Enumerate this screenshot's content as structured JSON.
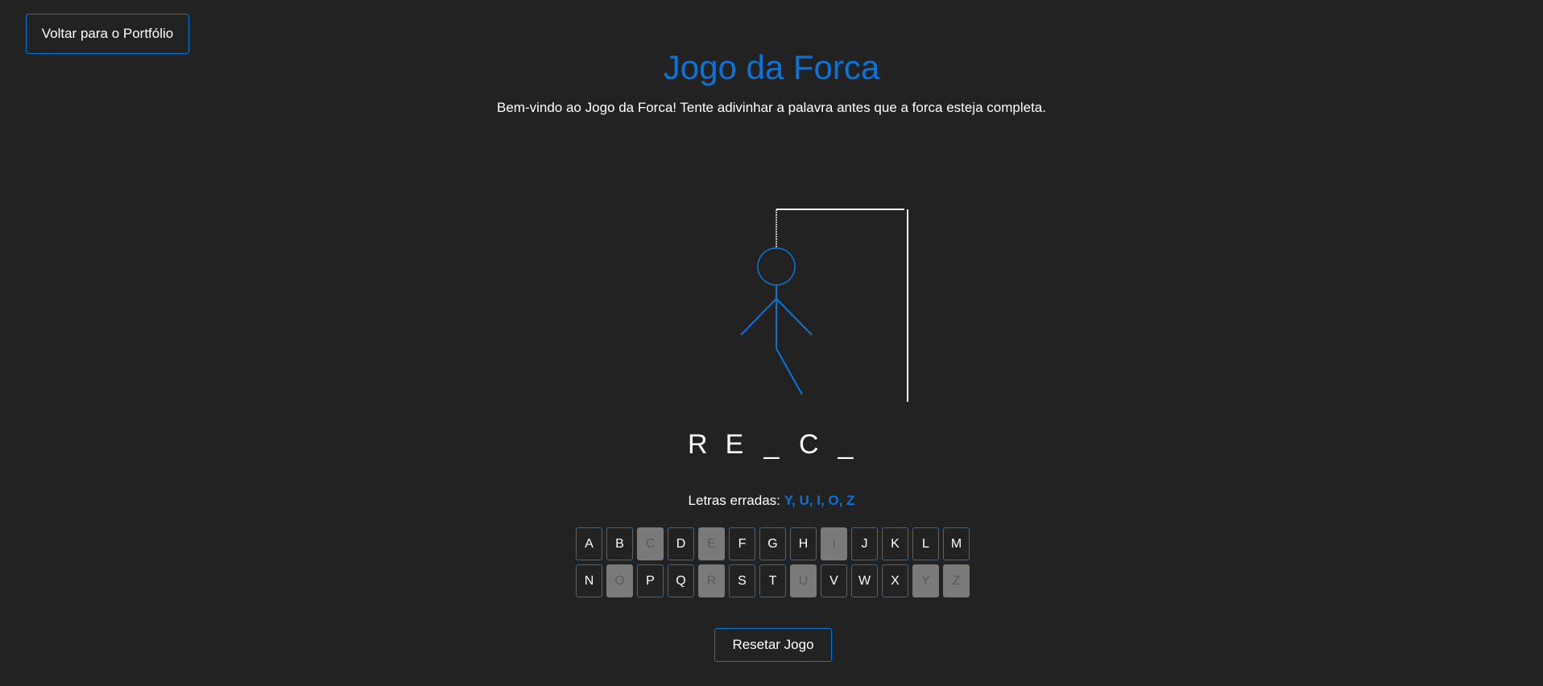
{
  "back_button": {
    "label": "Voltar para o Portfólio"
  },
  "header": {
    "title": "Jogo da Forca",
    "subtitle": "Bem-vindo ao Jogo da Forca! Tente adivinhar a palavra antes que a forca esteja completa."
  },
  "word": {
    "letters": [
      "R",
      "E",
      "_",
      "C",
      "_"
    ]
  },
  "wrong": {
    "label": "Letras erradas: ",
    "letters": "Y, U, I, O, Z"
  },
  "keyboard": {
    "rows": [
      [
        "A",
        "B",
        "C",
        "D",
        "E",
        "F",
        "G",
        "H",
        "I",
        "J",
        "K",
        "L",
        "M"
      ],
      [
        "N",
        "O",
        "P",
        "Q",
        "R",
        "S",
        "T",
        "U",
        "V",
        "W",
        "X",
        "Y",
        "Z"
      ]
    ],
    "disabled": [
      "C",
      "E",
      "I",
      "O",
      "R",
      "U",
      "Y",
      "Z"
    ]
  },
  "reset_button": {
    "label": "Resetar Jogo"
  },
  "colors": {
    "background": "#222222",
    "accent": "#0a74da",
    "text": "#ffffff",
    "disabled_key": "#7a7a7a"
  }
}
